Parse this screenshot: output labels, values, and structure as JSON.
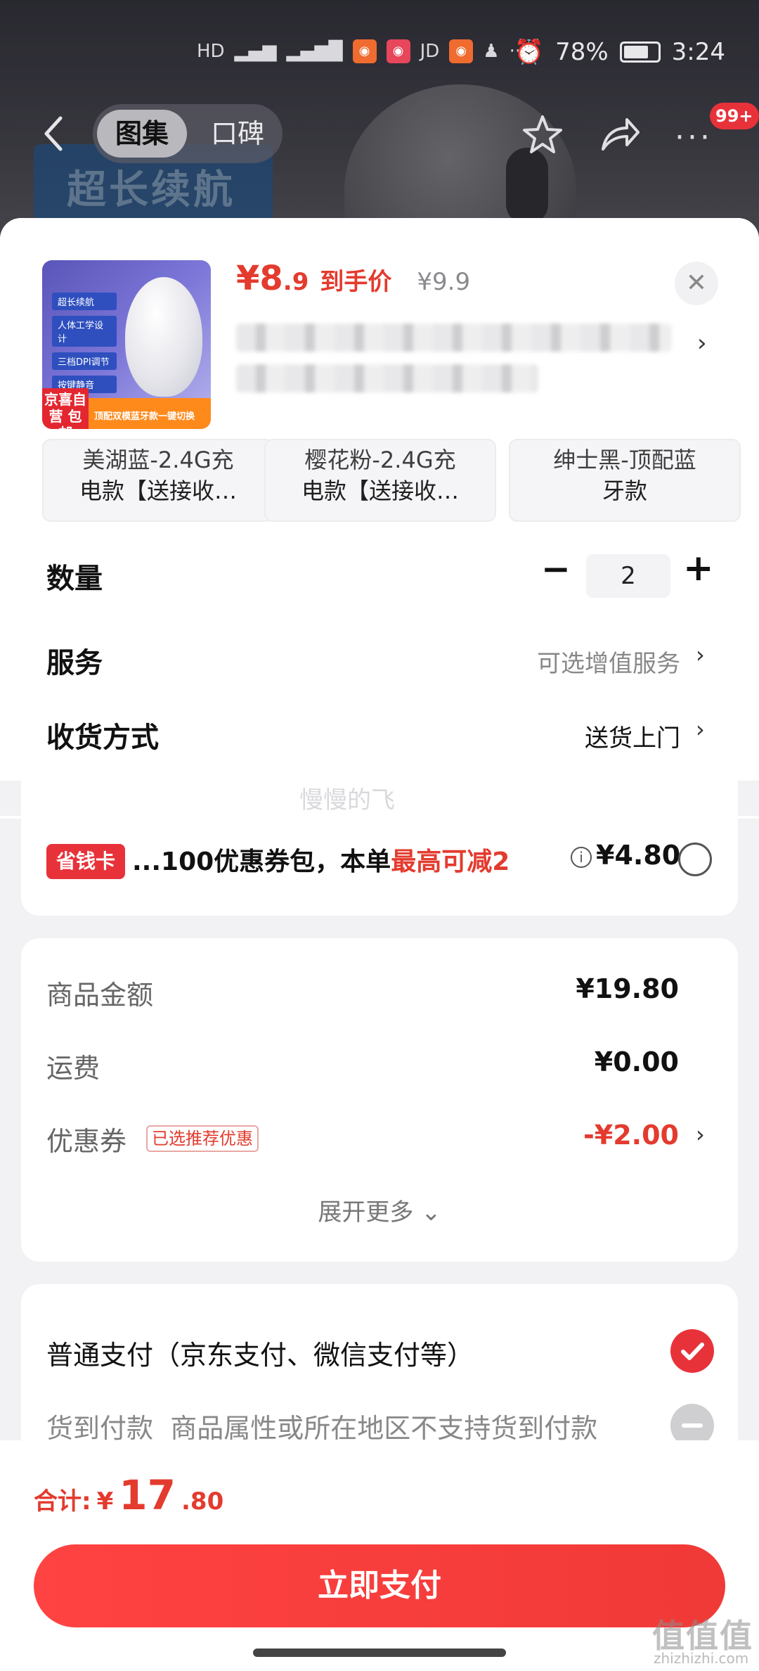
{
  "status_bar": {
    "battery": "78%",
    "time": "3:24",
    "jd_label": "JD",
    "more": "···"
  },
  "nav": {
    "tabs": [
      "图集",
      "口碑"
    ],
    "badge": "99+",
    "banner_text": "超长续航"
  },
  "product": {
    "price_int": "¥8",
    "price_dec": ".9",
    "price_label": "到手价",
    "price_old": "¥9.9",
    "thumb_tags": [
      "超长续航",
      "人体工学设计",
      "三档DPI调节",
      "按键静音"
    ],
    "thumb_footer_left": "京喜自营 包邮",
    "thumb_footer_right": "顶配双模蓝牙款一键切换"
  },
  "variants": [
    {
      "line1": "美湖蓝-2.4G充",
      "line2": "电款【送接收…"
    },
    {
      "line1": "樱花粉-2.4G充",
      "line2": "电款【送接收…"
    },
    {
      "line1": "绅士黑-顶配蓝",
      "line2": "牙款"
    }
  ],
  "quantity": {
    "label": "数量",
    "value": "2",
    "minus": "−",
    "plus": "+"
  },
  "service": {
    "label": "服务",
    "value": "可选增值服务"
  },
  "delivery": {
    "label": "收货方式",
    "value": "送货上门"
  },
  "watermark": "慢慢的飞",
  "coupon": {
    "tag": "省钱卡",
    "text_prefix": "...100优惠券包，本单",
    "text_highlight": "最高可减2",
    "price": "¥4.80"
  },
  "summary": {
    "goods_label": "商品金额",
    "goods_value": "¥19.80",
    "shipping_label": "运费",
    "shipping_value": "¥0.00",
    "coupon_label": "优惠券",
    "coupon_badge": "已选推荐优惠",
    "coupon_value": "-¥2.00",
    "expand": "展开更多"
  },
  "payment": {
    "normal": "普通支付（京东支付、微信支付等）",
    "cod_label": "货到付款",
    "cod_note": "商品属性或所在地区不支持货到付款"
  },
  "bottom": {
    "total_label": "合计:",
    "currency": "¥",
    "total_int": "17",
    "total_dec": ".80",
    "pay_button": "立即支付"
  },
  "site_logo": "值值值",
  "site_url": "zhizhizhi.com",
  "colors": {
    "accent": "#e33b2e",
    "button": "#f03a37"
  }
}
